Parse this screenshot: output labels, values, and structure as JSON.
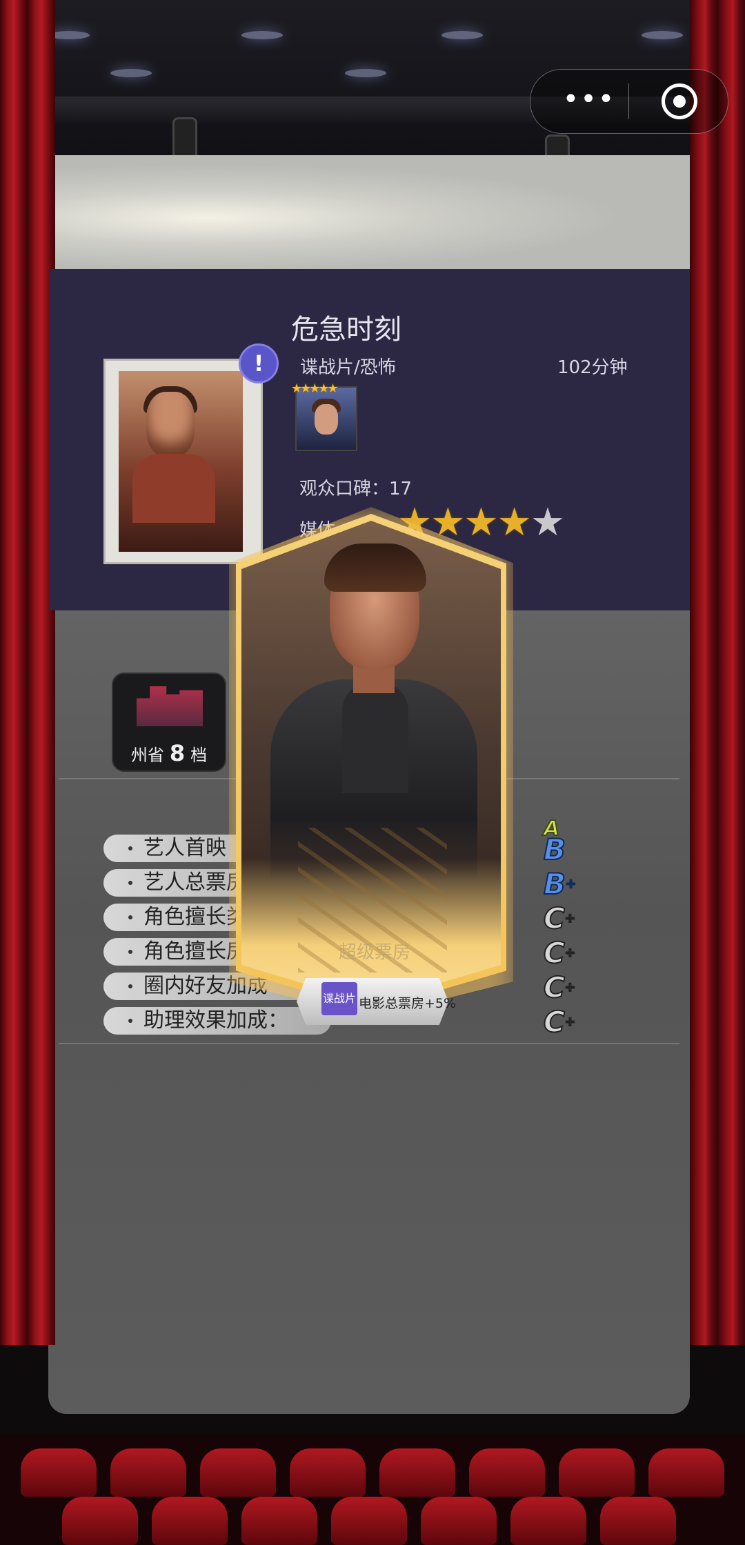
{
  "capsule": {
    "more_icon": "more-dots-icon",
    "close_icon": "target-circle-icon"
  },
  "movie": {
    "title": "危急时刻",
    "genre": "谍战片/恐怖",
    "duration": "102分钟",
    "audience_score_label": "观众口碑：17",
    "media_label_partial": "媒体",
    "media_stars": 4,
    "media_stars_max": 5,
    "actor_mini_stars": 5
  },
  "city": {
    "name": "州省",
    "level": "8",
    "suffix": "档"
  },
  "bonuses": [
    {
      "label": "艺人首映",
      "grade": "B",
      "plus": false
    },
    {
      "label": "艺人总票房",
      "grade": "B",
      "plus": true
    },
    {
      "label": "角色擅长类",
      "grade": "C",
      "plus": true
    },
    {
      "label": "角色擅长房",
      "grade": "C",
      "plus": true
    },
    {
      "label": "圈内好友加成",
      "grade": "C",
      "plus": true
    },
    {
      "label": "助理效果加成：",
      "grade": "C",
      "plus": true
    }
  ],
  "bonus_top_grade": "A",
  "card": {
    "watermark": "超级票房",
    "tag": "谍战片",
    "effect": "电影总票房+5%"
  },
  "colors": {
    "accent_gold": "#f3c457",
    "panel": "#2c2844",
    "tag_purple": "#6a52c8"
  }
}
